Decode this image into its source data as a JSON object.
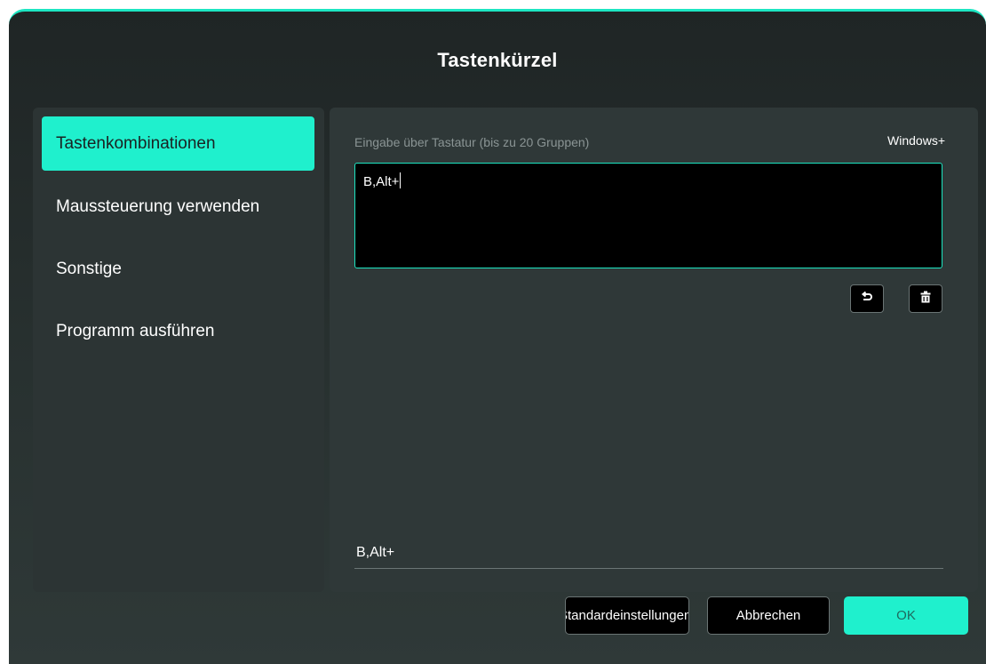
{
  "dialog": {
    "title": "Tastenkürzel"
  },
  "sidebar": {
    "items": [
      {
        "label": "Tastenkombinationen",
        "active": true
      },
      {
        "label": "Maussteuerung verwenden",
        "active": false
      },
      {
        "label": "Sonstige",
        "active": false
      },
      {
        "label": "Programm ausführen",
        "active": false
      }
    ]
  },
  "main": {
    "hint": "Eingabe über Tastatur (bis zu 20 Gruppen)",
    "modifier_label": "Windows+",
    "input_value": "B,Alt+",
    "result_value": "B,Alt+",
    "undo_icon": "undo-icon",
    "delete_icon": "trash-icon"
  },
  "footer": {
    "default_label": "Standardeinstellungen",
    "cancel_label": "Abbrechen",
    "ok_label": "OK"
  },
  "colors": {
    "accent": "#1ff0cd",
    "background": "#283130",
    "input_bg": "#000000"
  }
}
